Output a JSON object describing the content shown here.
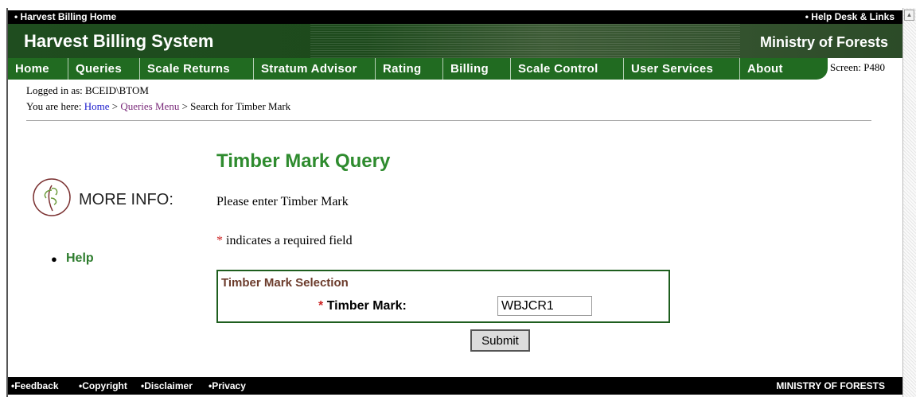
{
  "top_bar": {
    "home_link": "• Harvest Billing Home",
    "help_link": "• Help Desk & Links"
  },
  "banner": {
    "title": "Harvest Billing System",
    "ministry": "Ministry of Forests"
  },
  "nav": {
    "items": [
      "Home",
      "Queries",
      "Scale Returns",
      "Stratum Advisor",
      "Rating",
      "Billing",
      "Scale Control",
      "User Services",
      "About"
    ]
  },
  "screen_id": "Screen: P480",
  "login": "Logged in as: BCEID\\BTOM",
  "breadcrumb": {
    "prefix": "You are here:",
    "home": "Home",
    "sep1": ">",
    "queries_menu": "Queries Menu",
    "sep2": ">",
    "current": "Search for Timber Mark"
  },
  "more_info": {
    "label": "MORE INFO:",
    "help_link": "Help"
  },
  "main": {
    "title": "Timber Mark Query",
    "instruction": "Please enter Timber Mark",
    "required_star": "*",
    "required_note": "indicates a required field",
    "selection": {
      "legend": "Timber Mark Selection",
      "field_star": "*",
      "field_label": "Timber Mark:",
      "field_value": "WBJCR1"
    },
    "submit_label": "Submit"
  },
  "footer": {
    "links": [
      "•Feedback",
      "•Copyright",
      "•Disclaimer",
      "•Privacy"
    ],
    "ministry": "MINISTRY OF FORESTS"
  },
  "colors": {
    "nav_green": "#216b21",
    "title_green": "#2e8b2e",
    "required_red": "#cc2222"
  }
}
